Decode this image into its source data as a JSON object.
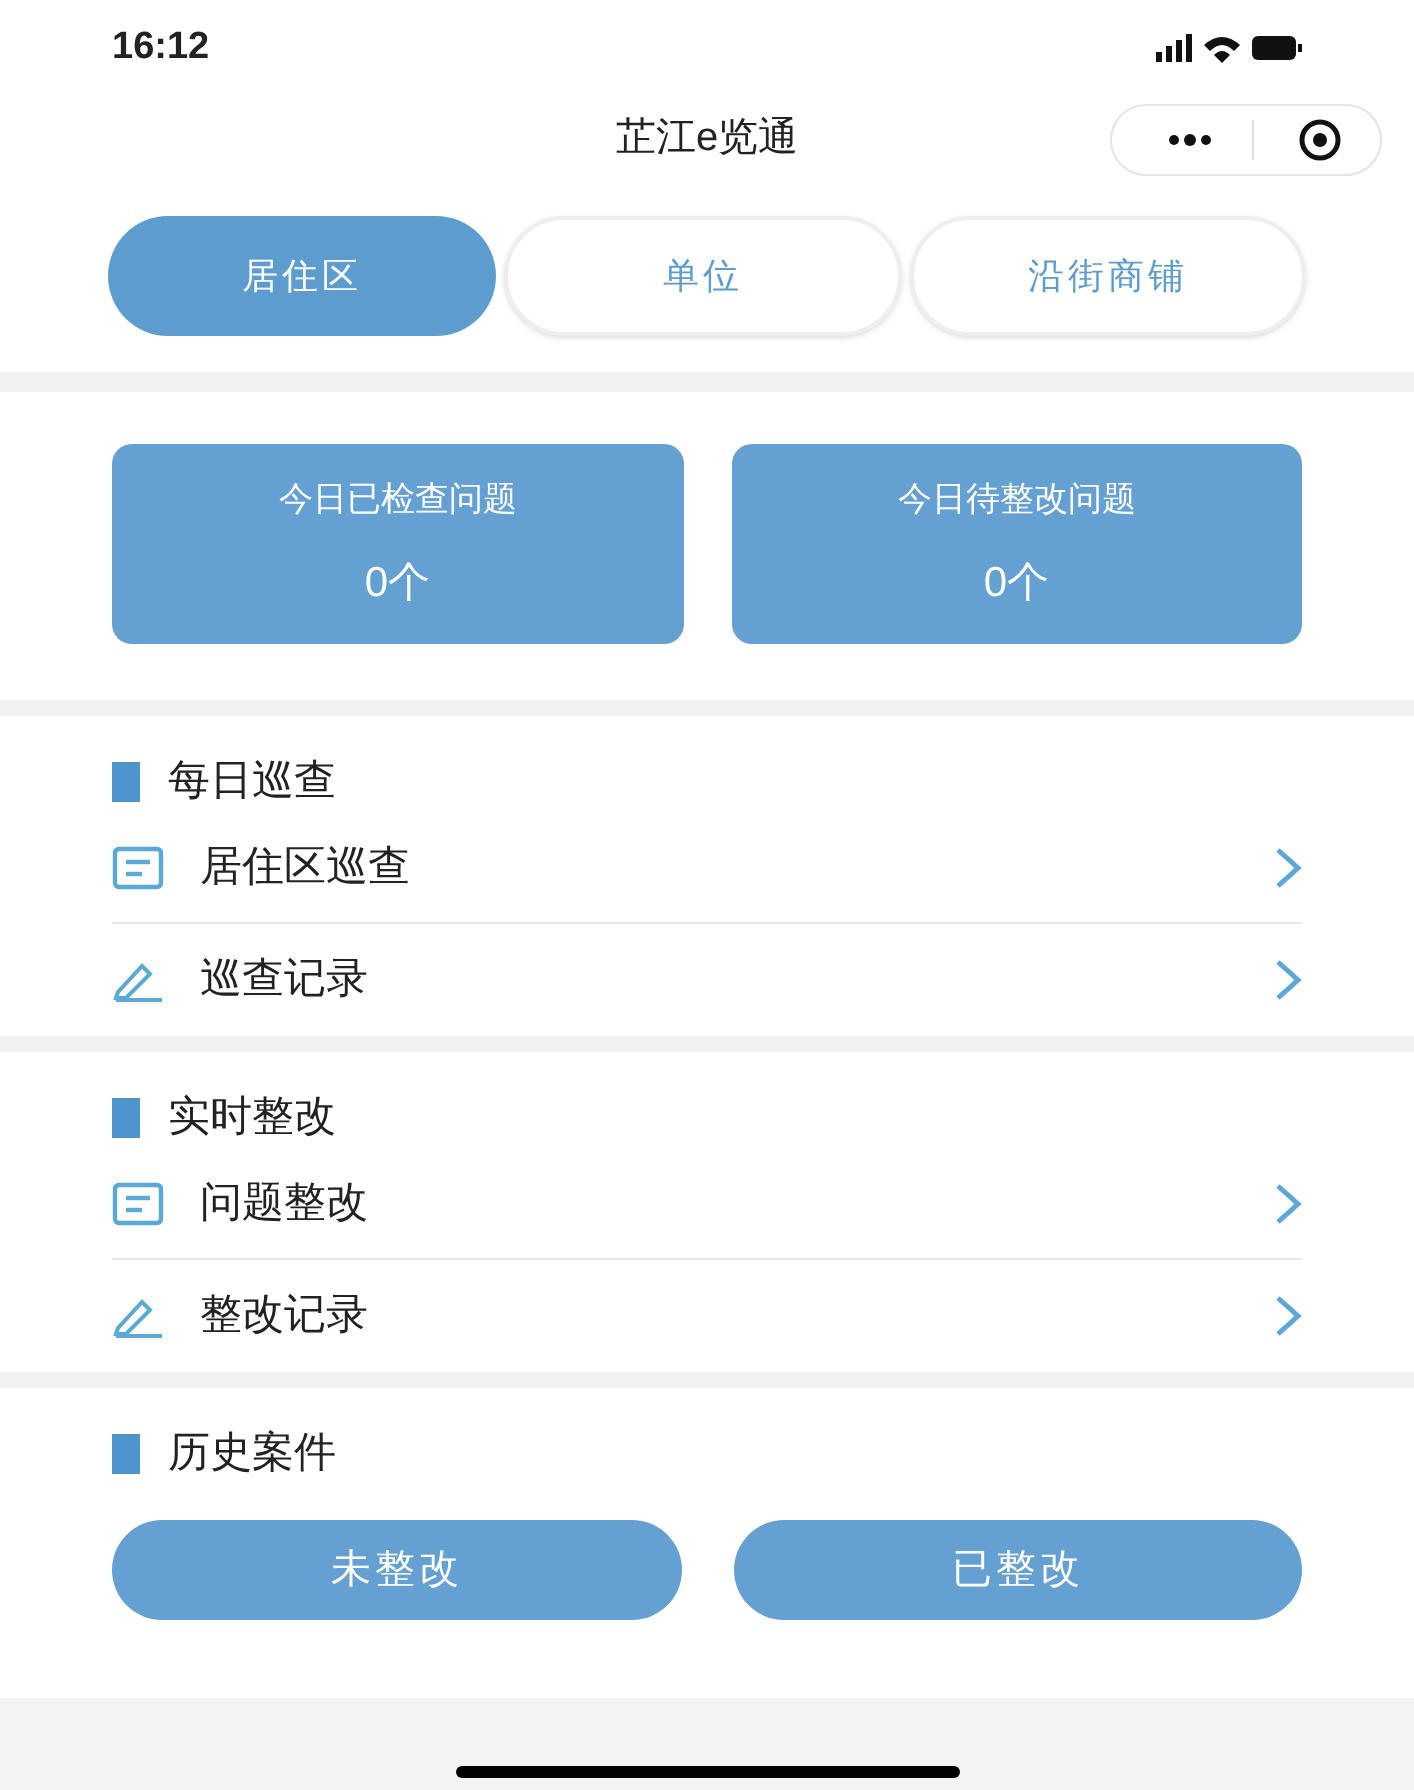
{
  "status_bar": {
    "time": "16:12"
  },
  "title": "芷江e览通",
  "tabs": [
    {
      "label": "居住区",
      "selected": true
    },
    {
      "label": "单位",
      "selected": false
    },
    {
      "label": "沿街商铺",
      "selected": false
    }
  ],
  "stats": [
    {
      "label": "今日已检查问题",
      "value": "0个"
    },
    {
      "label": "今日待整改问题",
      "value": "0个"
    }
  ],
  "sections": [
    {
      "title": "每日巡查",
      "items": [
        {
          "label": "居住区巡查",
          "kind": "doc"
        },
        {
          "label": "巡查记录",
          "kind": "pen"
        }
      ]
    },
    {
      "title": "实时整改",
      "items": [
        {
          "label": "问题整改",
          "kind": "doc"
        },
        {
          "label": "整改记录",
          "kind": "pen"
        }
      ]
    }
  ],
  "history": {
    "title": "历史案件",
    "buttons": [
      "未整改",
      "已整改"
    ]
  }
}
